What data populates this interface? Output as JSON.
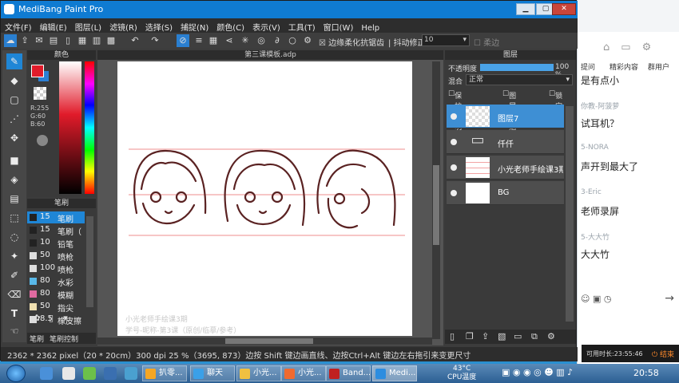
{
  "app": {
    "title": "MediBang Paint Pro",
    "menu": [
      "文件(F)",
      "编辑(E)",
      "图层(L)",
      "滤镜(R)",
      "选择(S)",
      "捕捉(N)",
      "颜色(C)",
      "表示(V)",
      "工具(T)",
      "窗口(W)",
      "Help"
    ],
    "toolbar": {
      "antialias_label": "边缘柔化抗锯齿",
      "stabilizer_label": "抖动修正",
      "stabilizer_value": "10",
      "soft_label": "柔边"
    }
  },
  "color_panel": {
    "title": "颜色",
    "fg_color": "#e11b2a",
    "bg_color": "#2c7fd4",
    "rgb": [
      "R:255",
      "G:60",
      "B:60"
    ]
  },
  "brush_panel": {
    "title": "笔刷",
    "brushes": [
      {
        "size": "15",
        "name": "笔刷",
        "color": "#222222",
        "selected": true
      },
      {
        "size": "15",
        "name": "笔刷（",
        "color": "#222222",
        "selected": false
      },
      {
        "size": "10",
        "name": "铅笔",
        "color": "#222222",
        "selected": false
      },
      {
        "size": "50",
        "name": "喷枪",
        "color": "#dddddd",
        "selected": false
      },
      {
        "size": "100",
        "name": "喷枪",
        "color": "#dddddd",
        "selected": false
      },
      {
        "size": "80",
        "name": "水彩",
        "color": "#58b8e8",
        "selected": false
      },
      {
        "size": "80",
        "name": "模糊",
        "color": "#e06aa0",
        "selected": false
      },
      {
        "size": "50",
        "name": "指尖",
        "color": "#f0e0b0",
        "selected": false
      },
      {
        "size": "8.5",
        "name": "橡皮擦",
        "color": "#dddddd",
        "selected": false
      }
    ],
    "tabs": [
      "笔刷",
      "笔刷控制"
    ]
  },
  "canvas": {
    "tab_title": "第三课模板.adp",
    "watermark_line1": "小光老师手绘课3期",
    "watermark_line2": "学号-昵称-第3课（原创/临摹/参考）"
  },
  "layer_panel": {
    "title": "图层",
    "opacity_label": "不透明度",
    "opacity_value": "100 %",
    "opacity": 1.0,
    "blend_label": "混合",
    "blend_value": "正常",
    "checks": [
      "保护透明度",
      "图层剪贴",
      "锁定"
    ],
    "layers": [
      {
        "name": "图层7",
        "thumb": "checker",
        "selected": true
      },
      {
        "name": "仟仟",
        "thumb": "folder",
        "selected": false
      },
      {
        "name": "小光老师手绘课3期",
        "thumb": "lines",
        "selected": false
      },
      {
        "name": "BG",
        "thumb": "white",
        "selected": false
      }
    ]
  },
  "status_bar": {
    "text": "2362 * 2362 pixel（20 * 20cm）300 dpi  25 %（3695, 873）边按 Shift 键边画直线、边按Ctrl+Alt 键边左右拖引来变更尺寸"
  },
  "chat": {
    "tabs": [
      "提问",
      "精彩内容",
      "群用户"
    ],
    "messages": [
      {
        "user": "",
        "text": "是有点小"
      },
      {
        "user": "你教-阿菠萝",
        "text": "试耳机？"
      },
      {
        "user": "5-NORA",
        "text": "声开到最大了"
      },
      {
        "user": "3-Eric",
        "text": "老师录屏"
      },
      {
        "user": "5-大大竹",
        "text": "大大竹"
      }
    ],
    "elapsed_label": "可用时长:23:55:46",
    "end_label": "结束"
  },
  "taskbar": {
    "items": [
      {
        "label": "扒零...",
        "color": "#f5a623"
      },
      {
        "label": "聊天",
        "color": "#3aa0e8"
      },
      {
        "label": "小光...",
        "color": "#f0c040"
      },
      {
        "label": "小光...",
        "color": "#f06a30"
      },
      {
        "label": "Band...",
        "color": "#c02020"
      },
      {
        "label": "Medi...",
        "color": "#2c8de0"
      }
    ],
    "temperature": "43°C",
    "cpu_label": "CPU温度",
    "clock": "20:58"
  }
}
